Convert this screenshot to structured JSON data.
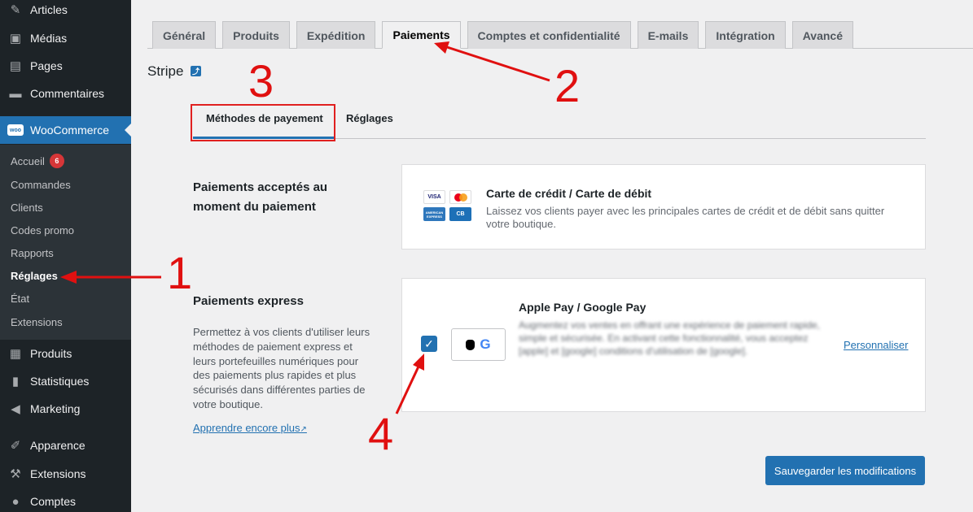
{
  "sidebar": {
    "items": [
      {
        "label": "Articles",
        "icon": "pin-icon"
      },
      {
        "label": "Médias",
        "icon": "media-icon"
      },
      {
        "label": "Pages",
        "icon": "pages-icon"
      },
      {
        "label": "Commentaires",
        "icon": "comments-icon"
      },
      {
        "label": "WooCommerce",
        "icon": "woocommerce-icon"
      },
      {
        "label": "Produits",
        "icon": "products-icon"
      },
      {
        "label": "Statistiques",
        "icon": "stats-icon"
      },
      {
        "label": "Marketing",
        "icon": "megaphone-icon"
      },
      {
        "label": "Apparence",
        "icon": "brush-icon"
      },
      {
        "label": "Extensions",
        "icon": "plugin-icon"
      },
      {
        "label": "Comptes",
        "icon": "user-icon"
      }
    ],
    "woo_logo": "woo",
    "submenu": [
      {
        "label": "Accueil",
        "badge": "6"
      },
      {
        "label": "Commandes"
      },
      {
        "label": "Clients"
      },
      {
        "label": "Codes promo"
      },
      {
        "label": "Rapports"
      },
      {
        "label": "Réglages"
      },
      {
        "label": "État"
      },
      {
        "label": "Extensions"
      }
    ]
  },
  "tabs": [
    "Général",
    "Produits",
    "Expédition",
    "Paiements",
    "Comptes et confidentialité",
    "E-mails",
    "Intégration",
    "Avancé"
  ],
  "active_tab": "Paiements",
  "stripe": {
    "title": "Stripe",
    "icon_glyph": "⤴"
  },
  "subtabs": [
    "Méthodes de payement",
    "Réglages"
  ],
  "accepted": {
    "heading": "Paiements acceptés au moment du paiement",
    "card_title": "Carte de crédit / Carte de débit",
    "card_desc": "Laissez vos clients payer avec les principales cartes de crédit et de débit sans quitter votre boutique.",
    "logos": {
      "visa": "VISA",
      "amex": "AMERICAN EXPRESS",
      "cb": "CB"
    }
  },
  "express": {
    "heading": "Paiements express",
    "desc": "Permettez à vos clients d'utiliser leurs méthodes de paiement express et leurs portefeuilles numériques pour des paiements plus rapides et plus sécurisés dans différentes parties de votre boutique.",
    "learn_more": "Apprendre encore plus",
    "card_title": "Apple Pay / Google Pay",
    "card_desc_blurred": "Augmentez vos ventes en offrant une expérience de paiement rapide, simple et sécurisée. En activant cette fonctionnalité, vous acceptez [apple] et [google] conditions d'utilisation de [google].",
    "customize": "Personnaliser",
    "checked": true,
    "apple_glyph": "",
    "google_glyph": "G"
  },
  "save_button": "Sauvegarder les modifications",
  "annotations": [
    "1",
    "2",
    "3",
    "4"
  ],
  "annotation_color": "#e01010",
  "accent_color": "#2271b1"
}
